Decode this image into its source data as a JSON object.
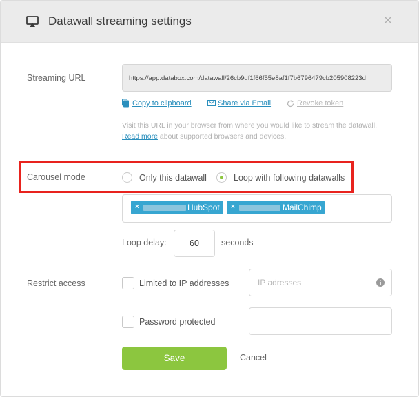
{
  "dialog": {
    "title": "Datawall streaming settings",
    "close_icon": "close-icon"
  },
  "streaming": {
    "label": "Streaming URL",
    "url": "https://app.databox.com/datawall/26cb9df1f66f55e8af1f7b6796479cb205908223d",
    "copy_link": "Copy to clipboard",
    "share_link": "Share via Email",
    "revoke_link": "Revoke token",
    "help_prefix": "Visit this URL in your browser from where you would like to stream the datawall.",
    "help_link": "Read more",
    "help_suffix": "about supported browsers and devices."
  },
  "carousel": {
    "label": "Carousel mode",
    "option_single": "Only this datawall",
    "option_loop": "Loop with following datawalls",
    "selected": "loop",
    "tags": [
      {
        "name": "HubSpot"
      },
      {
        "name": "MailChimp"
      }
    ],
    "delay_label": "Loop delay:",
    "delay_value": "60",
    "delay_unit": "seconds"
  },
  "restrict": {
    "label": "Restrict access",
    "ip_label": "Limited to IP addresses",
    "ip_placeholder": "IP adresses",
    "password_label": "Password protected",
    "password_value": ""
  },
  "actions": {
    "save": "Save",
    "cancel": "Cancel"
  },
  "colors": {
    "accent_green": "#8cc63f",
    "link_blue": "#2a8fbd",
    "tag_blue": "#37a6d1",
    "highlight_red": "#e8231e"
  }
}
